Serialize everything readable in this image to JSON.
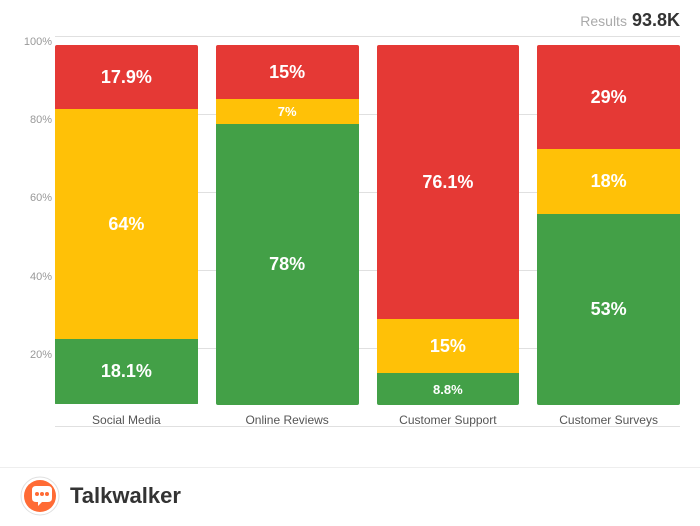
{
  "header": {
    "results_label": "Results",
    "results_value": "93.8K"
  },
  "y_axis": {
    "labels": [
      "100%",
      "80%",
      "60%",
      "40%",
      "20%",
      ""
    ]
  },
  "bars": [
    {
      "label": "Social Media",
      "segments": [
        {
          "color": "red",
          "height_pct": 17.9,
          "text": "17.9%"
        },
        {
          "color": "yellow",
          "height_pct": 64,
          "text": "64%"
        },
        {
          "color": "green",
          "height_pct": 18.1,
          "text": "18.1%"
        }
      ]
    },
    {
      "label": "Online Reviews",
      "segments": [
        {
          "color": "red",
          "height_pct": 15,
          "text": "15%"
        },
        {
          "color": "yellow",
          "height_pct": 7,
          "text": "7%"
        },
        {
          "color": "green",
          "height_pct": 78,
          "text": "78%"
        }
      ]
    },
    {
      "label": "Customer Support",
      "segments": [
        {
          "color": "red",
          "height_pct": 76.1,
          "text": "76.1%"
        },
        {
          "color": "yellow",
          "height_pct": 15,
          "text": "15%"
        },
        {
          "color": "green",
          "height_pct": 8.8,
          "text": "8.8%"
        }
      ]
    },
    {
      "label": "Customer Surveys",
      "segments": [
        {
          "color": "red",
          "height_pct": 29,
          "text": "29%"
        },
        {
          "color": "yellow",
          "height_pct": 18,
          "text": "18%"
        },
        {
          "color": "green",
          "height_pct": 53,
          "text": "53%"
        }
      ]
    }
  ],
  "footer": {
    "logo_text": "Talkwalker"
  },
  "chart_total_height": 360
}
